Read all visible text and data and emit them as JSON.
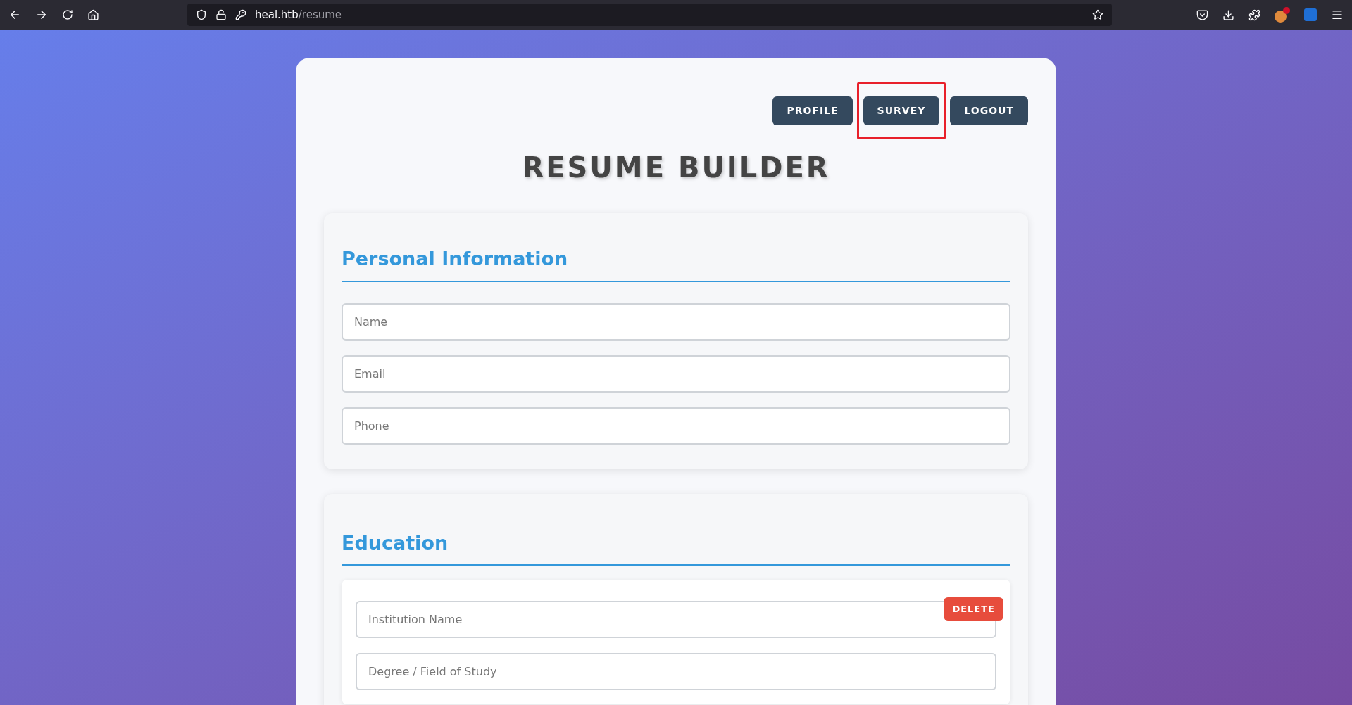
{
  "browser": {
    "url_host": "heal.htb",
    "url_path": "/resume"
  },
  "nav_buttons": [
    {
      "label": "PROFILE",
      "highlighted": false
    },
    {
      "label": "SURVEY",
      "highlighted": true
    },
    {
      "label": "LOGOUT",
      "highlighted": false
    }
  ],
  "title": "RESUME BUILDER",
  "personal_information": {
    "heading": "Personal Information",
    "fields": [
      {
        "placeholder": "Name"
      },
      {
        "placeholder": "Email"
      },
      {
        "placeholder": "Phone"
      }
    ]
  },
  "education": {
    "heading": "Education",
    "entries": [
      {
        "delete_label": "DELETE",
        "fields": [
          {
            "placeholder": "Institution Name"
          },
          {
            "placeholder": "Degree / Field of Study"
          }
        ]
      }
    ]
  }
}
